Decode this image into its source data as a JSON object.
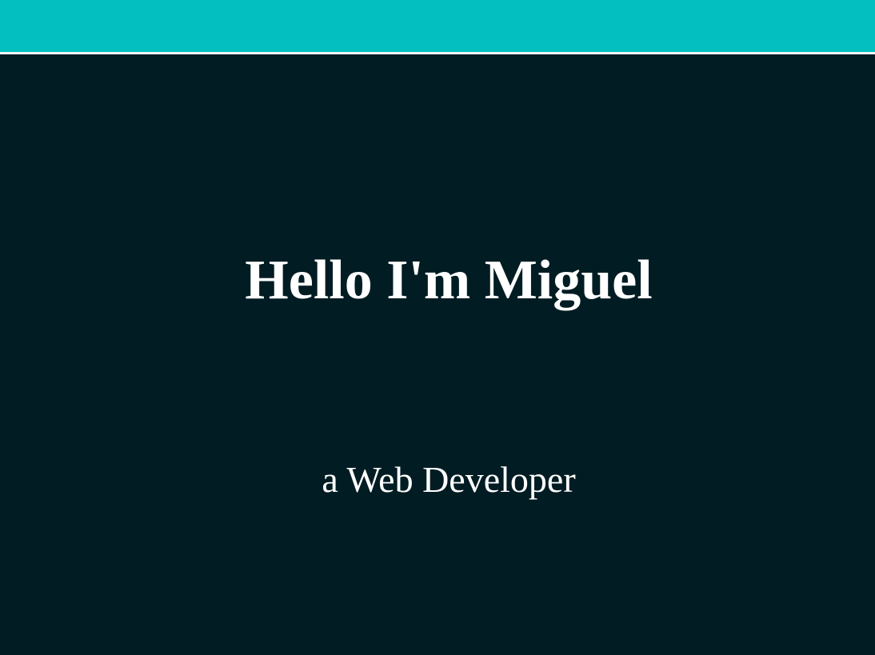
{
  "header": {
    "accent_color": "#03bfbf"
  },
  "hero": {
    "title": "Hello I'm Miguel",
    "subtitle": "a Web Developer",
    "background_color": "#021c23",
    "text_color": "#ffffff"
  }
}
